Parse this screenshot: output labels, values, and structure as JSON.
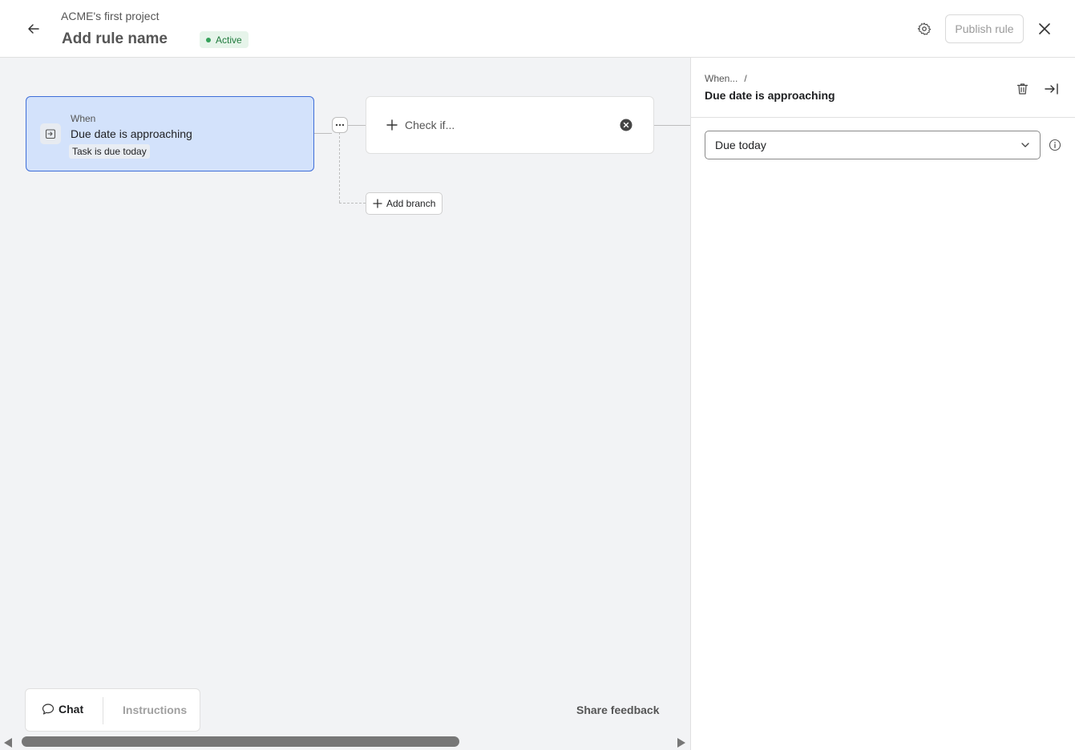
{
  "header": {
    "project_name": "ACME's first project",
    "rule_name": "Add rule name",
    "status": "Active",
    "publish_label": "Publish rule"
  },
  "canvas": {
    "trigger": {
      "label": "When",
      "title": "Due date is approaching",
      "chip": "Task is due today"
    },
    "condition": {
      "placeholder": "Check if..."
    },
    "add_branch_label": "Add branch"
  },
  "footer": {
    "chat_label": "Chat",
    "instructions_label": "Instructions",
    "share_feedback_label": "Share feedback"
  },
  "panel": {
    "breadcrumb": "When...",
    "breadcrumb_separator": "/",
    "title": "Due date is approaching",
    "select_value": "Due today"
  },
  "colors": {
    "accent": "#3f6ed8",
    "card_selected_bg": "#d3e2fb",
    "status_green": "#1f7a3c"
  }
}
